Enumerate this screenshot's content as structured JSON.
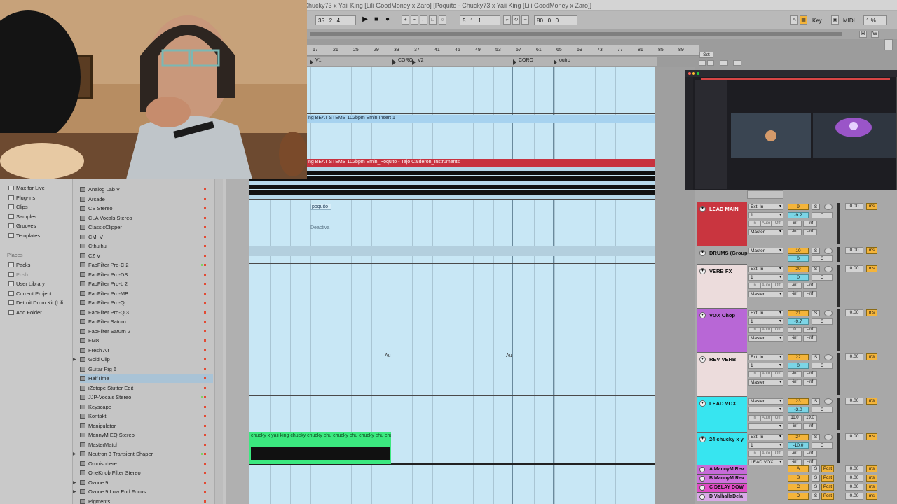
{
  "window": {
    "title": "Poquito - Chucky73 x Yaii King [Lili GoodMoney x Zaro]  [Poquito - Chucky73 x Yaii King [Lili GoodMoney x Zaro]]"
  },
  "transport": {
    "position": "35 .  2 .  4",
    "loop_start": "5 .  1 .  1",
    "loop_length": "80 .  0 .  0",
    "key_label": "Key",
    "midi_label": "MIDI",
    "cpu": "1 %",
    "h_label": "H",
    "w_label": "W",
    "set_label": "Set"
  },
  "ruler": {
    "ticks": [
      "17",
      "21",
      "25",
      "29",
      "33",
      "37",
      "41",
      "45",
      "49",
      "53",
      "57",
      "61",
      "65",
      "69",
      "73",
      "77",
      "81",
      "85",
      "89"
    ]
  },
  "locators": [
    "V1",
    "CORO",
    "V2",
    "CORO",
    "outro"
  ],
  "clips": {
    "stems_insert": "ng BEAT STEMS 102bpm Emin  Insert 1",
    "stems_main": "ng BEAT STEMS 102bpm Emin_Poquito - Tejo Calderon_Instruments",
    "poquito": "poquito",
    "deactivated": "Deactiva",
    "vocal": "chucky x yaii king  chucky  chucky  chu  chucky  chu  chucky  chu  chu",
    "auto1": "Au",
    "auto2": "Au"
  },
  "browser": {
    "categories": [
      "Max for Live",
      "Plug-ins",
      "Clips",
      "Samples",
      "Grooves",
      "Templates"
    ],
    "places_header": "Places",
    "places": [
      "Packs",
      "Push",
      "User Library",
      "Current Project",
      "Detroit Drum Kit (Lili",
      "Add Folder..."
    ],
    "plugins_top": "Analog Lab V",
    "plugins": [
      "Analog Lab V",
      "Arcade",
      "CS Stereo",
      "CLA Vocals Stereo",
      "ClassicClipper",
      "CMI V",
      "Cthulhu",
      "CZ V",
      "FabFilter Pro-C 2",
      "FabFilter Pro-DS",
      "FabFilter Pro-L 2",
      "FabFilter Pro-MB",
      "FabFilter Pro-Q",
      "FabFilter Pro-Q 3",
      "FabFilter Saturn",
      "FabFilter Saturn 2",
      "FM8",
      "Fresh Air",
      "Gold Clip",
      "Guitar Rig 6",
      "HalfTime",
      "iZotope Stutter Edit",
      "JJP-Vocals Stereo",
      "Keyscape",
      "Kontakt",
      "Manipulator",
      "MannyM EQ Stereo",
      "MasterMatch",
      "Neutron 3 Transient Shaper",
      "Omnisphere",
      "OneKnob Filter Stereo",
      "Ozone 9",
      "Ozone 9 Low End Focus",
      "Pigments"
    ]
  },
  "mixer": {
    "tracks": [
      {
        "name": "LEAD MAIN",
        "color": "#c9353f",
        "input": "Ext. In",
        "ch": "1",
        "out": "Master",
        "num": "9",
        "vol": "-9.2",
        "pan": "C",
        "sendL": "-inf",
        "sendR": "-inf",
        "sendval": "0.00",
        "ms": "ms"
      },
      {
        "name": "DRUMS (Group",
        "color": "#a8a8a8",
        "input": "Master",
        "ch": "",
        "out": "",
        "num": "10",
        "vol": "0",
        "pan": "C",
        "sendL": "",
        "sendR": "",
        "sendval": "0.00",
        "ms": "ms"
      },
      {
        "name": "VERB FX",
        "color": "#ecdcdc",
        "input": "Ext. In",
        "ch": "1",
        "out": "Master",
        "num": "20",
        "vol": "0",
        "pan": "C",
        "sendL": "-inf",
        "sendR": "-inf",
        "sendval": "0.00",
        "ms": "ms"
      },
      {
        "name": "VOX Chop",
        "color": "#b867d6",
        "input": "Ext. In",
        "ch": "1",
        "out": "Master",
        "num": "21",
        "vol": "-9.7",
        "pan": "C",
        "sendL": "0",
        "sendR": "-inf",
        "sendval": "0.00",
        "ms": "ms"
      },
      {
        "name": "REV VERB",
        "color": "#ecdcdc",
        "input": "Ext. In",
        "ch": "1",
        "out": "Master",
        "num": "22",
        "vol": "0",
        "pan": "C",
        "sendL": "-inf",
        "sendR": "-inf",
        "sendval": "0.00",
        "ms": "ms"
      },
      {
        "name": "LEAD VOX",
        "color": "#37e5f0",
        "input": "Master",
        "ch": "",
        "out": "",
        "num": "23",
        "vol": "-3.0",
        "pan": "C",
        "sendL": "11.0",
        "sendR": "19.0",
        "sendval": "0.00",
        "ms": "ms"
      },
      {
        "name": "24 chucky x y",
        "color": "#37e5f0",
        "input": "Ext. In",
        "ch": "1",
        "out": "LEAD VOX",
        "num": "24",
        "vol": "-10.0",
        "pan": "C",
        "sendL": "-inf",
        "sendR": "-inf",
        "sendval": "0.00",
        "ms": "ms"
      }
    ],
    "returns": [
      {
        "name": "A MannyM Rev",
        "color": "#c66bd8",
        "letter": "A",
        "post": "Post",
        "sendval": "0.00",
        "ms": "ms"
      },
      {
        "name": "B MannyM Rev",
        "color": "#d072de",
        "letter": "B",
        "post": "Post",
        "sendval": "0.00",
        "ms": "ms"
      },
      {
        "name": "C DELAY DOW",
        "color": "#e34cc8",
        "letter": "C",
        "post": "Post",
        "sendval": "0.00",
        "ms": "ms"
      },
      {
        "name": "D ValhallaDela",
        "color": "#d9a9e8",
        "letter": "D",
        "post": "Post",
        "sendval": "0.00",
        "ms": "ms"
      }
    ]
  },
  "colors": {
    "arrangement": "#c8e7f5",
    "stems_clip": "#a6d2ef",
    "stems_main_clip": "#c8323f",
    "vocal_clip": "#3be87f",
    "num_box": "#f4b43a",
    "volume_box": "#7cd5e6"
  }
}
